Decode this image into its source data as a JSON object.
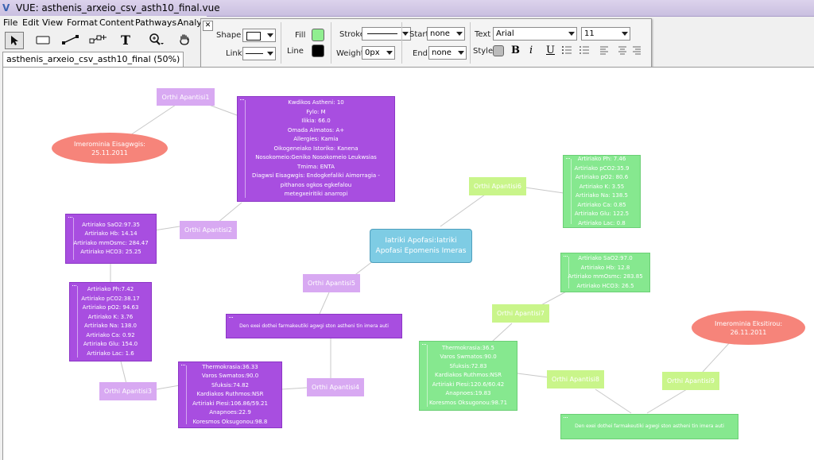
{
  "window": {
    "title": "VUE: asthenis_arxeio_csv_asth10_final.vue"
  },
  "menu": [
    "File",
    "Edit",
    "View",
    "Format",
    "Content",
    "Pathways",
    "Analy"
  ],
  "tab": {
    "label": "asthenis_arxeio_csv_asth10_final (50%)"
  },
  "props": {
    "shape_label": "Shape",
    "link_label": "Link",
    "fill_label": "Fill",
    "line_label": "Line",
    "stroke_label": "Stroke",
    "weight_label": "Weight",
    "weight_value": "0px",
    "start_label": "Start",
    "start_value": "none",
    "end_label": "End",
    "end_value": "none",
    "text_label": "Text",
    "font_value": "Arial",
    "size_value": "11",
    "style_label": "Style",
    "fill_color": "#90ee90",
    "line_color": "#000000"
  },
  "nodes": {
    "center": [
      "Iatriki Apofasi:Iatriki",
      "Apofasi Epomenis Imeras"
    ],
    "date_in": [
      "Imerominia Eisagwgis:",
      "25.11.2011"
    ],
    "date_out": [
      "Imerominia Eksitirou:",
      "26.11.2011"
    ],
    "orthi1": "Orthi Apantisi1",
    "orthi2": "Orthi Apantisi2",
    "orthi3": "Orthi Apantisi3",
    "orthi4": "Orthi Apantisi4",
    "orthi5": "Orthi Apantisi5",
    "orthi6": "Orthi Apantisi6",
    "orthi7": "Orthi Apantisi7",
    "orthi8": "Orthi Apantisi8",
    "orthi9": "Orthi Apantisi9",
    "patient_info": [
      "Kwdikos Asthenі: 10",
      "Fylo: M",
      "Ilikia: 66.0",
      "Omada Aimatos: A+",
      "Allergies: Kamia",
      "Oikogeneiako    Istoriko:  Kanena",
      "Nosokomeio:Geniko Nosokomeio Leukwsias",
      "Tmima: ENTA",
      "Diagwsi Eisagwgis:  Endogkefaliki Aimorragia -",
      "pithanos ogkos egkefalou",
      "metegxeiritiki anarropi"
    ],
    "p_blood1": [
      "Artiriako SaO2:97.35",
      "Artiriako Hb: 14.14",
      "Artiriako  mmOsmc: 284.47",
      "Artiriako HCO3:  25.25"
    ],
    "p_blood2": [
      "Artiriako Ph:7.42",
      "Artiriako pCO2:38.17",
      "Artiriako pO2:  94.63",
      "Artiriako K: 3.76",
      "Artiriako Na: 138.0",
      "Artiriako Ca: 0.92",
      "Artiriako Glu: 154.0",
      "Artiriako Lac: 1.6"
    ],
    "p_vitals": [
      "Thermokrasia:36.33",
      "Varos Swmatos:90.0",
      "Sfuksis:74.82",
      "Kardiakos Ruthmos:NSR",
      "Artiriaki Piesi:106.86/59.21",
      "Anapnoes:22.9",
      "Koresmos  Oksugonou:98.8"
    ],
    "p_med": "Den exei dothei farmakeutiki agwgi ston astheni tin imera auti",
    "g_blood1": [
      "Artiriako Ph: 7.46",
      "Artiriako pCO2:35.9",
      "Artiriako pO2:  80.6",
      "Artiriako K: 3.55",
      "Artiriako Na: 138.5",
      "Artiriako Ca: 0.85",
      "Artiriako Glu: 122.5",
      "Artiriako Lac: 0.8"
    ],
    "g_blood2": [
      "Artiriako SaO2:97.0",
      "Artiriako Hb: 12.8",
      "Artiriako  mmOsmc: 283.85",
      "Artiriako HCO3:  26.5"
    ],
    "g_vitals": [
      "Thermokrasia:36.5",
      "Varos Swmatos:90.0",
      "Sfuksis:72.83",
      "Kardiakos Ruthmos:NSR",
      "Artiriaki Piesi:120.6/60.42",
      "Anapnoes:19.83",
      "Koresmos  Oksugonou:98.71"
    ],
    "g_med": "Den exei dothei farmakeutiki agwgi ston astheni tin imera auti"
  }
}
